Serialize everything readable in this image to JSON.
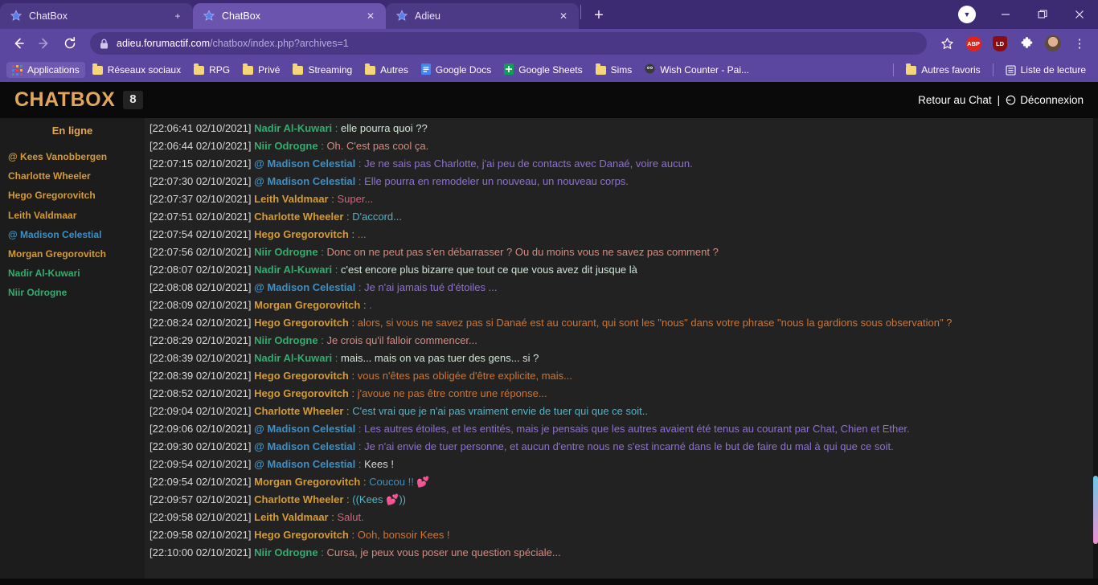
{
  "browser": {
    "tabs": [
      {
        "title": "ChatBox",
        "favicon": "star-favicon",
        "active": false
      },
      {
        "title": "ChatBox",
        "favicon": "star-favicon",
        "active": true
      },
      {
        "title": "Adieu",
        "favicon": "star-favicon",
        "active": false
      }
    ],
    "new_tab_label": "+",
    "tab_close_label": "×",
    "window_controls": {
      "profile_label": "▼",
      "minimize_label": "—",
      "maximize_label": "❐",
      "close_label": "✕"
    },
    "toolbar": {
      "back_label": "←",
      "forward_label": "→",
      "reload_label": "⟳",
      "lock_icon": "lock-icon",
      "url_host": "adieu.forumactif.com",
      "url_path": "/chatbox/index.php?archives=1",
      "bookmark_star_label": "☆",
      "extensions": [
        {
          "name": "adblock-plus",
          "label": "ABP",
          "color": "#e2231a"
        },
        {
          "name": "lastpass",
          "label": "LD",
          "color": "#8b0d12"
        },
        {
          "name": "extensions-puzzle",
          "label": "🧩",
          "color": "#ffffff"
        }
      ],
      "menu_label": "⋮"
    },
    "bookmarks": {
      "items": [
        {
          "label": "Applications",
          "icon": "apps-grid-icon"
        },
        {
          "label": "Réseaux sociaux",
          "icon": "folder-icon"
        },
        {
          "label": "RPG",
          "icon": "folder-icon"
        },
        {
          "label": "Privé",
          "icon": "folder-icon"
        },
        {
          "label": "Streaming",
          "icon": "folder-icon"
        },
        {
          "label": "Autres",
          "icon": "folder-icon"
        },
        {
          "label": "Google Docs",
          "icon": "google-docs-icon"
        },
        {
          "label": "Google Sheets",
          "icon": "google-sheets-icon"
        },
        {
          "label": "Sims",
          "icon": "folder-icon"
        },
        {
          "label": "Wish Counter - Pai...",
          "icon": "wish-counter-icon"
        }
      ],
      "right_items": [
        {
          "label": "Autres favoris",
          "icon": "folder-icon"
        },
        {
          "label": "Liste de lecture",
          "icon": "reading-list-icon"
        }
      ]
    }
  },
  "chatbox": {
    "title": "CHATBOX",
    "unread_count": "8",
    "back_to_chat_label": "Retour au Chat",
    "separator": "|",
    "logout_label": "Déconnexion",
    "logout_icon": "power-icon",
    "online_title": "En ligne",
    "online_users": [
      {
        "name": "@ Kees Vanobbergen",
        "color": "#d69a31"
      },
      {
        "name": "Charlotte Wheeler",
        "color": "#d69a31"
      },
      {
        "name": "Hego Gregorovitch",
        "color": "#d69a31"
      },
      {
        "name": "Leith Valdmaar",
        "color": "#d69a31"
      },
      {
        "name": "@ Madison Celestial",
        "color": "#3d8fc4"
      },
      {
        "name": "Morgan Gregorovitch",
        "color": "#d69a31"
      },
      {
        "name": "Nadir Al-Kuwari",
        "color": "#2fae6e"
      },
      {
        "name": "Niir Odrogne",
        "color": "#2fae6e"
      }
    ],
    "messages": [
      {
        "time": "[22:06:41 02/10/2021]",
        "user": "Nadir Al-Kuwari",
        "user_color": "#2fae6e",
        "text": "elle pourra quoi ??",
        "text_color": "#cfe7d4"
      },
      {
        "time": "[22:06:44 02/10/2021]",
        "user": "Niir Odrogne",
        "user_color": "#2fae6e",
        "text": "Oh. C'est pas cool ça.",
        "text_color": "#d98a7e"
      },
      {
        "time": "[22:07:15 02/10/2021]",
        "user": "@ Madison Celestial",
        "user_color": "#3d8fc4",
        "text": "Je ne sais pas Charlotte, j'ai peu de contacts avec Danaé, voire aucun.",
        "text_color": "#8f6fd6"
      },
      {
        "time": "[22:07:30 02/10/2021]",
        "user": "@ Madison Celestial",
        "user_color": "#3d8fc4",
        "text": "Elle pourra en remodeler un nouveau, un nouveau corps.",
        "text_color": "#8f6fd6"
      },
      {
        "time": "[22:07:37 02/10/2021]",
        "user": "Leith Valdmaar",
        "user_color": "#d69a31",
        "text": "Super...",
        "text_color": "#d9607a"
      },
      {
        "time": "[22:07:51 02/10/2021]",
        "user": "Charlotte Wheeler",
        "user_color": "#d69a31",
        "text": "D'accord...",
        "text_color": "#4fb4c9"
      },
      {
        "time": "[22:07:54 02/10/2021]",
        "user": "Hego Gregorovitch",
        "user_color": "#d69a31",
        "text": "...",
        "text_color": "#d4732b"
      },
      {
        "time": "[22:07:56 02/10/2021]",
        "user": "Niir Odrogne",
        "user_color": "#2fae6e",
        "text": "Donc on ne peut pas s'en débarrasser ? Ou du moins vous ne savez pas comment ?",
        "text_color": "#d98a7e"
      },
      {
        "time": "[22:08:07 02/10/2021]",
        "user": "Nadir Al-Kuwari",
        "user_color": "#2fae6e",
        "text": "c'est encore plus bizarre que tout ce que vous avez dit jusque là",
        "text_color": "#cfe7d4"
      },
      {
        "time": "[22:08:08 02/10/2021]",
        "user": "@ Madison Celestial",
        "user_color": "#3d8fc4",
        "text": "Je n'ai jamais tué d'étoiles ...",
        "text_color": "#8f6fd6"
      },
      {
        "time": "[22:08:09 02/10/2021]",
        "user": "Morgan Gregorovitch",
        "user_color": "#d69a31",
        "text": ".",
        "text_color": "#3d8fc4"
      },
      {
        "time": "[22:08:24 02/10/2021]",
        "user": "Hego Gregorovitch",
        "user_color": "#d69a31",
        "text": "alors, si vous ne savez pas si Danaé est au courant, qui sont les \"nous\" dans votre phrase \"nous la gardions sous observation\" ?",
        "text_color": "#d4732b"
      },
      {
        "time": "[22:08:29 02/10/2021]",
        "user": "Niir Odrogne",
        "user_color": "#2fae6e",
        "text": "Je crois qu'il falloir commencer...",
        "text_color": "#d98a7e"
      },
      {
        "time": "[22:08:39 02/10/2021]",
        "user": "Nadir Al-Kuwari",
        "user_color": "#2fae6e",
        "text": "mais... mais on va pas tuer des gens... si ?",
        "text_color": "#cfe7d4"
      },
      {
        "time": "[22:08:39 02/10/2021]",
        "user": "Hego Gregorovitch",
        "user_color": "#d69a31",
        "text": "vous n'êtes pas obligée d'être explicite, mais...",
        "text_color": "#d4732b"
      },
      {
        "time": "[22:08:52 02/10/2021]",
        "user": "Hego Gregorovitch",
        "user_color": "#d69a31",
        "text": "j'avoue ne pas être contre une réponse...",
        "text_color": "#d4732b"
      },
      {
        "time": "[22:09:04 02/10/2021]",
        "user": "Charlotte Wheeler",
        "user_color": "#d69a31",
        "text": "C'est vrai que je n'ai pas vraiment envie de tuer qui que ce soit..",
        "text_color": "#4fb4c9"
      },
      {
        "time": "[22:09:06 02/10/2021]",
        "user": "@ Madison Celestial",
        "user_color": "#3d8fc4",
        "text": "Les autres étoiles, et les entités, mais je pensais que les autres avaient été tenus au courant par Chat, Chien et Ether.",
        "text_color": "#8f6fd6"
      },
      {
        "time": "[22:09:30 02/10/2021]",
        "user": "@ Madison Celestial",
        "user_color": "#3d8fc4",
        "text": "Je n'ai envie de tuer personne, et aucun d'entre nous ne s'est incarné dans le but de faire du mal à qui que ce soit.",
        "text_color": "#8f6fd6"
      },
      {
        "time": "[22:09:54 02/10/2021]",
        "user": "@ Madison Celestial",
        "user_color": "#3d8fc4",
        "text": "Kees !",
        "text_color": "#d8d8d8"
      },
      {
        "time": "[22:09:54 02/10/2021]",
        "user": "Morgan Gregorovitch",
        "user_color": "#d69a31",
        "text": "Coucou !! 💕",
        "text_color": "#3d8fc4"
      },
      {
        "time": "[22:09:57 02/10/2021]",
        "user": "Charlotte Wheeler",
        "user_color": "#d69a31",
        "text": "((Kees 💕))",
        "text_color": "#4fb4c9"
      },
      {
        "time": "[22:09:58 02/10/2021]",
        "user": "Leith Valdmaar",
        "user_color": "#d69a31",
        "text": "Salut.",
        "text_color": "#d9607a"
      },
      {
        "time": "[22:09:58 02/10/2021]",
        "user": "Hego Gregorovitch",
        "user_color": "#d69a31",
        "text": "Ooh, bonsoir Kees !",
        "text_color": "#d4732b"
      },
      {
        "time": "[22:10:00 02/10/2021]",
        "user": "Niir Odrogne",
        "user_color": "#2fae6e",
        "text": "Cursa, je peux vous poser une question spéciale...",
        "text_color": "#d98a7e"
      }
    ]
  }
}
